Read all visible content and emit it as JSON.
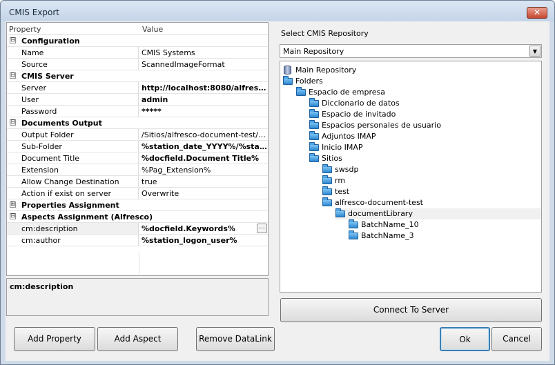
{
  "window": {
    "title": "CMIS Export",
    "close_glyph": "✕"
  },
  "grid": {
    "headers": {
      "property": "Property",
      "value": "Value"
    },
    "rows": [
      {
        "type": "category",
        "label": "Configuration",
        "expander": "⊟"
      },
      {
        "type": "prop",
        "name": "Name",
        "value": "CMIS Systems",
        "bold": false
      },
      {
        "type": "prop",
        "name": "Source",
        "value": "ScannedImageFormat",
        "bold": false
      },
      {
        "type": "category",
        "label": "CMIS Server",
        "expander": "⊟"
      },
      {
        "type": "prop",
        "name": "Server",
        "value": "http://localhost:8080/alfresco...",
        "bold": true
      },
      {
        "type": "prop",
        "name": "User",
        "value": "admin",
        "bold": true
      },
      {
        "type": "prop",
        "name": "Password",
        "value": "*****",
        "bold": true
      },
      {
        "type": "category",
        "label": "Documents Output",
        "expander": "⊟"
      },
      {
        "type": "prop",
        "name": "Output Folder",
        "value": "/Sitios/alfresco-document-test/docu...",
        "bold": false
      },
      {
        "type": "prop",
        "name": "Sub-Folder",
        "value": "%station_date_YYYY%/%stati...",
        "bold": true
      },
      {
        "type": "prop",
        "name": "Document Title",
        "value": "%docfield.Document Title%",
        "bold": true
      },
      {
        "type": "prop",
        "name": "Extension",
        "value": "%Pag_Extension%",
        "bold": false
      },
      {
        "type": "prop",
        "name": "Allow Change Destination",
        "value": "true",
        "bold": false
      },
      {
        "type": "prop",
        "name": "Action if exist on server",
        "value": "Overwrite",
        "bold": false
      },
      {
        "type": "category",
        "label": "Properties Assignment",
        "expander": "⊞"
      },
      {
        "type": "category",
        "label": "Aspects Assignment (Alfresco)",
        "expander": "⊟"
      },
      {
        "type": "prop",
        "name": "cm:description",
        "value": "%docfield.Keywords%",
        "bold": true,
        "selected": true,
        "ellipsis": "..."
      },
      {
        "type": "prop",
        "name": "cm:author",
        "value": "%station_logon_user%",
        "bold": true
      }
    ]
  },
  "description": {
    "text": "cm:description"
  },
  "buttons": {
    "add_property": "Add Property",
    "add_aspect": "Add Aspect",
    "remove_datalink": "Remove DataLink",
    "connect": "Connect To Server",
    "ok": "Ok",
    "cancel": "Cancel"
  },
  "repository": {
    "label": "Select CMIS Repository",
    "selected": "Main Repository",
    "arrow_glyph": "▼"
  },
  "tree": [
    {
      "label": "Main Repository",
      "level": 0,
      "icon": "database-icon"
    },
    {
      "label": "Folders",
      "level": 0,
      "icon": "folder-icon"
    },
    {
      "label": "Espacio de empresa",
      "level": 1,
      "icon": "folder-icon"
    },
    {
      "label": "Diccionario de datos",
      "level": 2,
      "icon": "folder-icon"
    },
    {
      "label": "Espacio de invitado",
      "level": 2,
      "icon": "folder-icon"
    },
    {
      "label": "Espacios personales de usuario",
      "level": 2,
      "icon": "folder-icon"
    },
    {
      "label": "Adjuntos IMAP",
      "level": 2,
      "icon": "folder-icon"
    },
    {
      "label": "Inicio IMAP",
      "level": 2,
      "icon": "folder-icon"
    },
    {
      "label": "Sitios",
      "level": 2,
      "icon": "folder-icon"
    },
    {
      "label": "swsdp",
      "level": 3,
      "icon": "folder-icon"
    },
    {
      "label": "rm",
      "level": 3,
      "icon": "folder-icon"
    },
    {
      "label": "test",
      "level": 3,
      "icon": "folder-icon"
    },
    {
      "label": "alfresco-document-test",
      "level": 3,
      "icon": "folder-icon"
    },
    {
      "label": "documentLibrary",
      "level": 4,
      "icon": "folder-icon",
      "selected": true
    },
    {
      "label": "BatchName_10",
      "level": 5,
      "icon": "folder-icon"
    },
    {
      "label": "BatchName_3",
      "level": 5,
      "icon": "folder-icon"
    }
  ]
}
